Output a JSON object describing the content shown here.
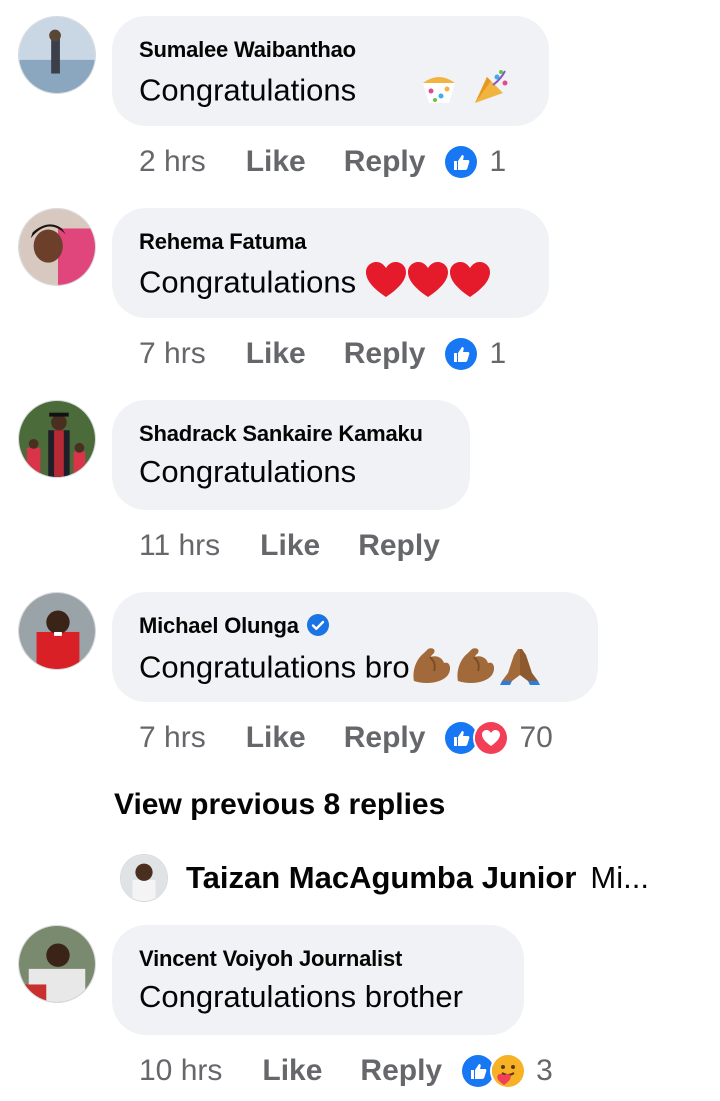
{
  "comments": [
    {
      "name": "Sumalee Waibanthao",
      "text": "Congratulations",
      "time": "2 hrs",
      "like": "Like",
      "reply": "Reply",
      "reaction_count": "1",
      "reactions": [
        "like-icon"
      ],
      "emojis": [
        "confetti-ball-icon",
        "party-popper-icon"
      ]
    },
    {
      "name": "Rehema Fatuma",
      "text": "Congratulations",
      "time": "7 hrs",
      "like": "Like",
      "reply": "Reply",
      "reaction_count": "1",
      "reactions": [
        "like-icon"
      ],
      "emojis": [
        "red-heart-icon",
        "red-heart-icon",
        "red-heart-icon"
      ]
    },
    {
      "name": "Shadrack Sankaire Kamaku",
      "text": "Congratulations",
      "time": "11 hrs",
      "like": "Like",
      "reply": "Reply"
    },
    {
      "name": "Michael Olunga",
      "verified": true,
      "text": "Congratulations bro",
      "time": "7 hrs",
      "like": "Like",
      "reply": "Reply",
      "reaction_count": "70",
      "reactions": [
        "like-icon",
        "love-icon"
      ],
      "emojis": [
        "flexed-biceps-icon",
        "flexed-biceps-icon",
        "folded-hands-icon"
      ]
    },
    {
      "name": "Vincent Voiyoh Journalist",
      "text": "Congratulations brother",
      "time": "10 hrs",
      "like": "Like",
      "reply": "Reply",
      "reaction_count": "3",
      "reactions": [
        "like-icon",
        "care-icon"
      ]
    }
  ],
  "view_previous": "View previous 8 replies",
  "reply_preview": {
    "name": "Taizan MacAgumba Junior",
    "text": "Mi..."
  },
  "colors": {
    "bubble": "#f0f2f5",
    "meta": "#65676b",
    "like_blue": "#1877f2",
    "love_red": "#f33e58",
    "verified_blue": "#1b74e4"
  }
}
